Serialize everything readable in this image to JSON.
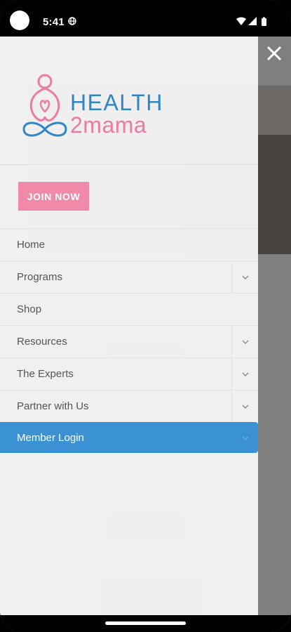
{
  "status_bar": {
    "time": "5:41",
    "icons": [
      "globe-icon",
      "wifi-icon",
      "signal-icon",
      "battery-icon"
    ]
  },
  "drawer": {
    "logo": {
      "word1": "HEALTH",
      "word2": "2mama"
    },
    "join_button": "JOIN NOW",
    "nav_items": [
      {
        "label": "Home",
        "has_submenu": false
      },
      {
        "label": "Programs",
        "has_submenu": true
      },
      {
        "label": "Shop",
        "has_submenu": false
      },
      {
        "label": "Resources",
        "has_submenu": true
      },
      {
        "label": "The Experts",
        "has_submenu": true
      },
      {
        "label": "Partner with Us",
        "has_submenu": true
      },
      {
        "label": "Member Login",
        "has_submenu": true,
        "active": true
      }
    ]
  },
  "colors": {
    "brand_blue": "#2f86c6",
    "brand_pink": "#ec7aa1",
    "join_button": "#f08aa8",
    "active_item": "#3a92d5"
  }
}
